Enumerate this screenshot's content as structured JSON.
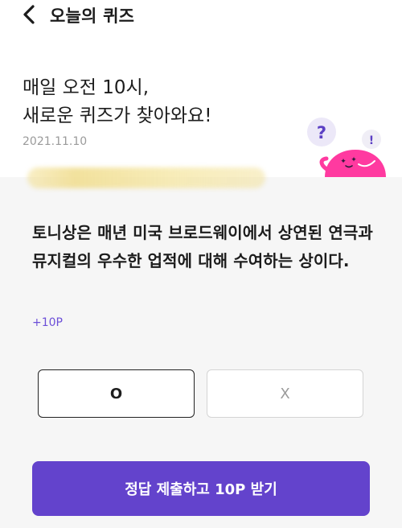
{
  "header": {
    "title": "오늘의 퀴즈",
    "back_icon": "chevron-left-icon"
  },
  "hero": {
    "headline_line1": "매일 오전 10시,",
    "headline_line2": "새로운 퀴즈가 찾아와요!",
    "date": "2021.11.10"
  },
  "mascot": {
    "question_mark": "?",
    "exclaim_mark": "!",
    "sparkle": "✦",
    "color": "#ff3aa0"
  },
  "quiz": {
    "question": "토니상은 매년 미국 브로드웨이에서 상연된 연극과 뮤지컬의 우수한 업적에 대해 수여하는 상이다.",
    "points": "+10P",
    "options": [
      {
        "label": "O",
        "selected": true
      },
      {
        "label": "X",
        "selected": false
      }
    ],
    "submit_label": "정답 제출하고 10P 받기"
  },
  "colors": {
    "accent": "#6343cc",
    "points_text": "#6c4fd8",
    "background": "#f6f6f6"
  }
}
